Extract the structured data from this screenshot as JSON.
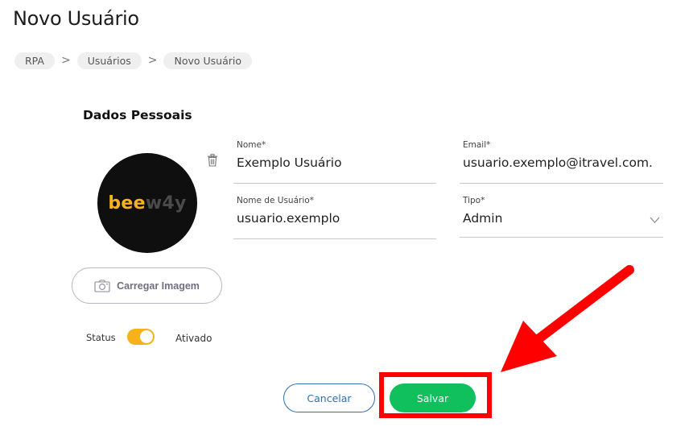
{
  "page": {
    "title": "Novo Usuário"
  },
  "breadcrumb": {
    "items": [
      "RPA",
      "Usuários",
      "Novo Usuário"
    ],
    "separator": ">"
  },
  "section": {
    "title": "Dados Pessoais"
  },
  "avatar": {
    "logo_text_a": "bee",
    "logo_text_b": "w4y"
  },
  "upload": {
    "label": "Carregar Imagem"
  },
  "status": {
    "label": "Status",
    "value": "Ativado",
    "enabled": true
  },
  "form": {
    "nome": {
      "label": "Nome*",
      "value": "Exemplo Usuário"
    },
    "email": {
      "label": "Email*",
      "value": "usuario.exemplo@itravel.com."
    },
    "username": {
      "label": "Nome de Usuário*",
      "value": "usuario.exemplo"
    },
    "tipo": {
      "label": "Tipo*",
      "value": "Admin"
    }
  },
  "actions": {
    "cancel_label": "Cancelar",
    "save_label": "Salvar"
  },
  "colors": {
    "accent_yellow": "#f6b21a",
    "save_green": "#0fc05c",
    "cancel_blue": "#2f6fb0",
    "annotation_red": "#ff0000"
  }
}
